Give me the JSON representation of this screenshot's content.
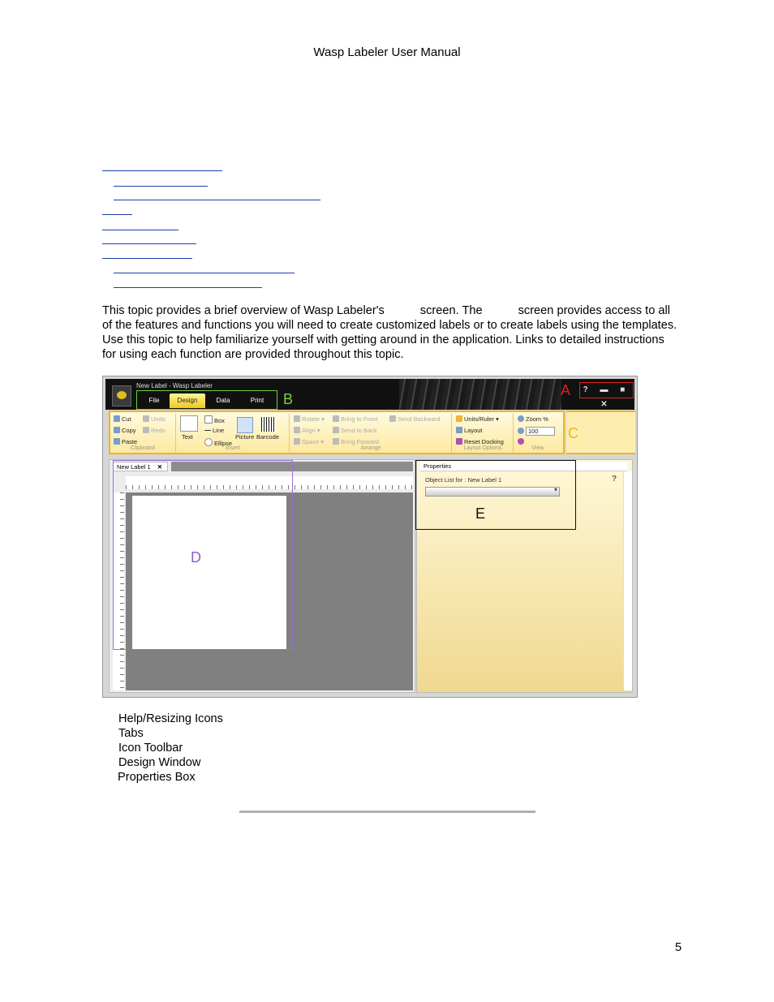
{
  "header": {
    "title": "Wasp Labeler User Manual"
  },
  "intro": {
    "part1": "This topic provides a brief overview of Wasp Labeler's",
    "part2": "screen.  The",
    "part3": "screen provides access to all of the features and functions you will need to create customized labels or to create labels using the  templates. Use this topic to help familiarize yourself with getting around in the application.  Links to detailed instructions for using each function are provided throughout this topic."
  },
  "screenshot": {
    "app_title": "New Label - Wasp Labeler",
    "tabs": [
      "File",
      "Design",
      "Data",
      "Print"
    ],
    "active_tab": "Design",
    "window_buttons": "? ▬ ■ ✕",
    "callouts": {
      "a": "A",
      "b": "B",
      "c": "C",
      "d": "D",
      "e": "E"
    },
    "ribbon": {
      "clipboard": {
        "cut": "Cut",
        "copy": "Copy",
        "paste": "Paste",
        "undo": "Undo",
        "redo": "Redo",
        "label": "Clipboard"
      },
      "insert": {
        "text": "Text",
        "box": "Box",
        "line": "Line",
        "ellipse": "Ellipse",
        "picture": "Picture",
        "barcode": "Barcode",
        "label": "Insert"
      },
      "arrange": {
        "rotate": "Rotate ▾",
        "align": "Align ▾",
        "space": "Space ▾",
        "bring_front": "Bring to Front",
        "send_back": "Send to Back",
        "bring_forward": "Bring Forward",
        "send_backward": "Send Backward",
        "label": "Arrange"
      },
      "layout": {
        "units": "Units/Ruler ▾",
        "layout": "Layout",
        "reset": "Reset Docking",
        "label": "Layout Options"
      },
      "view": {
        "zoom": "Zoom %",
        "zoom_value": "100",
        "label": "View"
      }
    },
    "design_tab": "New Label 1",
    "properties": {
      "title": "Properties",
      "object_list": "Object List for :  New Label 1",
      "help": "?"
    }
  },
  "legend": [
    "Help/Resizing Icons",
    "Tabs",
    "Icon Toolbar",
    "Design Window",
    "Properties Box"
  ],
  "page_number": "5",
  "colors": {
    "callout_a": "#e02020",
    "callout_b": "#7dd23c",
    "callout_c": "#f2b41f",
    "callout_d": "#8a5fd0",
    "link": "#1a3fb0"
  }
}
